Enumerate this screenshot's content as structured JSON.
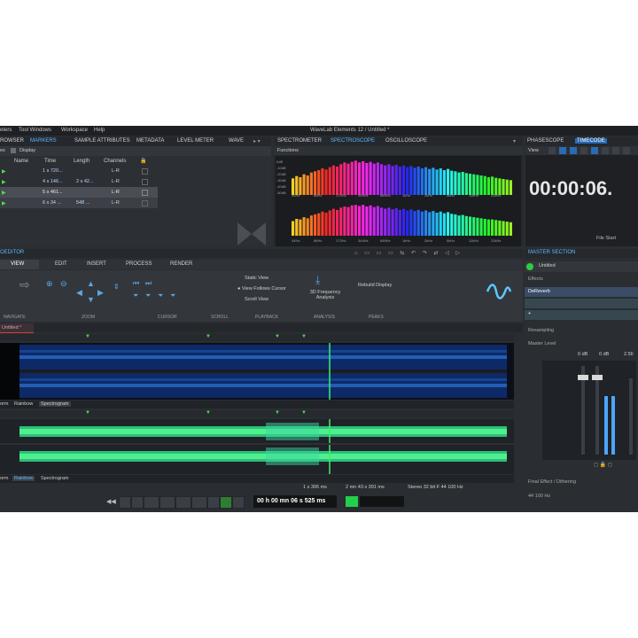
{
  "app": {
    "title": "WaveLab Elements 12 / Untitled *",
    "menu": [
      "eters",
      "Tool Windows",
      "Workspace",
      "Help"
    ]
  },
  "top_left_panel": {
    "tabs": [
      "ROWSER",
      "MARKERS",
      "SAMPLE ATTRIBUTES",
      "METADATA",
      "LEVEL METER",
      "WAVE"
    ],
    "toolbar": [
      "es",
      "Display"
    ],
    "columns": [
      "Name",
      "Time",
      "Length",
      "Channels"
    ],
    "rows": [
      {
        "time": "1 s 720...",
        "length": "",
        "channels": "L-R"
      },
      {
        "time": "4 s 146...",
        "length": "2 s 42...",
        "channels": "L-R"
      },
      {
        "time": "5 s 461...",
        "length": "",
        "channels": "L-R"
      },
      {
        "time": "6 s 34 ...",
        "length": "548 ...",
        "channels": "L-R"
      }
    ]
  },
  "spectro_panel": {
    "tabs": [
      "SPECTROMETER",
      "SPECTROSCOPE",
      "OSCILLOSCOPE"
    ],
    "functions_label": "Functions",
    "freq_labels": [
      "44Hz",
      "86Hz",
      "172Hz",
      "344Hz",
      "689Hz",
      "1kHz",
      "2kHz",
      "5kHz",
      "11kHz",
      "22kHz"
    ],
    "db_labels": [
      "0dB",
      "-10dB",
      "-20dB",
      "-30dB",
      "-40dB",
      "-50dB"
    ]
  },
  "phase_panel": {
    "tabs": [
      "PHASESCOPE",
      "TIMECODE"
    ],
    "view_label": "View",
    "timecode": "00:00:06.",
    "file_start": "File Start"
  },
  "editor": {
    "title": "OEDITOR",
    "ribbon_tabs": [
      "VIEW",
      "EDIT",
      "INSERT",
      "PROCESS",
      "RENDER"
    ],
    "groups": [
      "NAVIGATE",
      "ZOOM",
      "CURSOR",
      "SCROLL",
      "PLAYBACK",
      "ANALYSIS",
      "PEAKS"
    ],
    "playback": [
      "Static View",
      "View Follows Cursor",
      "Scroll View"
    ],
    "analysis": "3D Frequency Analysis",
    "peaks": "Rebuild Display",
    "file_tab": "Untitled *",
    "modes1": [
      "orm",
      "Rainbow",
      "Spectrogram"
    ],
    "modes2": [
      "orm",
      "Rainbow",
      "Spectrogram"
    ],
    "status": [
      "1 s 395 ms",
      "2 mn 43 s 391 ms",
      "Stereo 32 bit F 44 100 Hz"
    ]
  },
  "master": {
    "title": "MASTER SECTION",
    "preset": "Untitled",
    "effects": "Effects",
    "effect1": "DeReverb",
    "resampling": "Resampling",
    "master_level": "Master Level",
    "levels": [
      "0 dB",
      "0 dB",
      "2.56"
    ],
    "final": "Final Effect / Dithering",
    "rate": "44 100 Hz"
  },
  "transport": {
    "time": "00 h 00 mn 06 s 525 ms"
  },
  "spectrum_top": [
    28,
    32,
    30,
    35,
    33,
    38,
    40,
    42,
    45,
    43,
    47,
    50,
    48,
    52,
    55,
    53,
    56,
    58,
    55,
    57,
    54,
    56,
    53,
    55,
    52,
    50,
    52,
    49,
    51,
    48,
    50,
    47,
    49,
    46,
    48,
    45,
    47,
    44,
    46,
    43,
    45,
    42,
    44,
    41,
    40,
    38,
    39,
    37,
    36,
    35,
    34,
    33,
    32,
    30,
    31,
    29,
    28,
    27,
    26,
    25
  ],
  "spectrum_bottom": [
    26,
    30,
    29,
    33,
    31,
    36,
    38,
    40,
    43,
    41,
    45,
    48,
    46,
    50,
    52,
    51,
    54,
    55,
    53,
    55,
    52,
    54,
    51,
    53,
    50,
    48,
    50,
    47,
    49,
    46,
    48,
    45,
    47,
    44,
    46,
    43,
    45,
    42,
    44,
    41,
    43,
    40,
    42,
    39,
    38,
    36,
    37,
    35,
    34,
    33,
    32,
    31,
    30,
    29,
    29,
    28,
    27,
    26,
    25,
    24
  ]
}
